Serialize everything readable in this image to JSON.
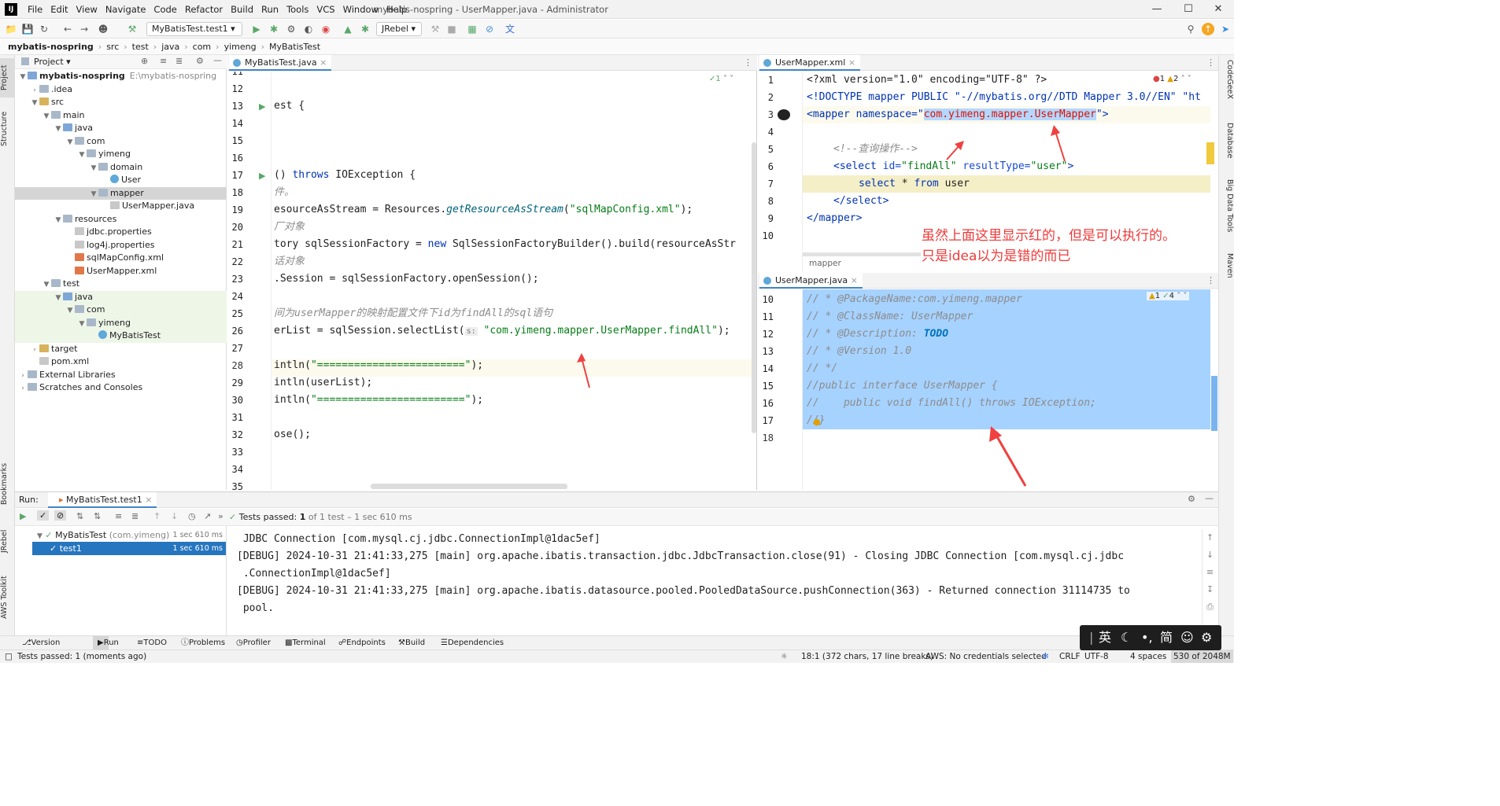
{
  "app": {
    "window_title": "mybatis-nospring - UserMapper.java - Administrator",
    "logo": "IJ",
    "menu": [
      "File",
      "Edit",
      "View",
      "Navigate",
      "Code",
      "Refactor",
      "Build",
      "Run",
      "Tools",
      "VCS",
      "Window",
      "Help"
    ]
  },
  "toolbar": {
    "run_config": "MyBatisTest.test1",
    "jrebel": "JRebel"
  },
  "breadcrumb": [
    "mybatis-nospring",
    "src",
    "test",
    "java",
    "com",
    "yimeng",
    "MyBatisTest"
  ],
  "left_stripe": {
    "project": "Project",
    "structure": "Structure",
    "bookmarks": "Bookmarks",
    "jrebel": "JRebel",
    "aws": "AWS Toolkit"
  },
  "right_stripe": {
    "codegeex": "CodeGeeX",
    "database": "Database",
    "bigdata": "Big Data Tools",
    "maven": "Maven"
  },
  "project": {
    "header": "Project",
    "root_path": "E:\\mybatis-nospring",
    "items": [
      {
        "label": "mybatis-nospring",
        "depth": 0
      },
      {
        "label": ".idea",
        "depth": 1
      },
      {
        "label": "src",
        "depth": 1
      },
      {
        "label": "main",
        "depth": 2
      },
      {
        "label": "java",
        "depth": 3
      },
      {
        "label": "com",
        "depth": 4
      },
      {
        "label": "yimeng",
        "depth": 5
      },
      {
        "label": "domain",
        "depth": 6
      },
      {
        "label": "User",
        "depth": 7
      },
      {
        "label": "mapper",
        "depth": 6
      },
      {
        "label": "UserMapper.java",
        "depth": 7
      },
      {
        "label": "resources",
        "depth": 3
      },
      {
        "label": "jdbc.properties",
        "depth": 4
      },
      {
        "label": "log4j.properties",
        "depth": 4
      },
      {
        "label": "sqlMapConfig.xml",
        "depth": 4
      },
      {
        "label": "UserMapper.xml",
        "depth": 4
      },
      {
        "label": "test",
        "depth": 2
      },
      {
        "label": "java",
        "depth": 3
      },
      {
        "label": "com",
        "depth": 4
      },
      {
        "label": "yimeng",
        "depth": 5
      },
      {
        "label": "MyBatisTest",
        "depth": 6
      },
      {
        "label": "target",
        "depth": 1
      },
      {
        "label": "pom.xml",
        "depth": 1
      },
      {
        "label": "External Libraries",
        "depth": 0
      },
      {
        "label": "Scratches and Consoles",
        "depth": 0
      }
    ]
  },
  "editor_left": {
    "tab": "MyBatisTest.java",
    "inspection": "1",
    "lines": [
      "11",
      "12",
      "13",
      "14",
      "15",
      "16",
      "17",
      "18",
      "19",
      "20",
      "21",
      "22",
      "23",
      "24",
      "25",
      "26",
      "27",
      "28",
      "29",
      "30",
      "31",
      "32",
      "33",
      "34",
      "35"
    ],
    "code": {
      "l13": "est {",
      "l17a": "() ",
      "l17b": "throws",
      "l17c": " IOException {",
      "l18": "件。",
      "l19a": "esourceAsStream = Resources.",
      "l19b": "getResourceAsStream",
      "l19c": "(",
      "l19d": "\"sqlMapConfig.xml\"",
      "l19e": ");",
      "l20": "厂对象",
      "l21a": "tory sqlSessionFactory = ",
      "l21b": "new",
      "l21c": " SqlSessionFactoryBuilder().build(resourceAsStr",
      "l22": "话对象",
      "l23": ".Session = sqlSessionFactory.openSession();",
      "l25": "间为userMapper的映射配置文件下id为findAll的sql语句",
      "l26a": "erList = sqlSession.selectList(",
      "l26hint": "s:",
      "l26b": "\"com.yimeng.mapper.UserMapper.findAll\"",
      "l26c": ");",
      "l28a": "intln(",
      "l28b": "\"========================\"",
      "l28c": ");",
      "l29": "intln(userList);",
      "l30a": "intln(",
      "l30b": "\"========================\"",
      "l30c": ");",
      "l32": "ose();"
    }
  },
  "editor_right_top": {
    "tab": "UserMapper.xml",
    "errors": "1",
    "warnings": "2",
    "lines": [
      "1",
      "2",
      "3",
      "4",
      "5",
      "6",
      "7",
      "8",
      "9",
      "10"
    ],
    "code": {
      "l1": "<?xml version=\"1.0\" encoding=\"UTF-8\" ?>",
      "l2": "<!DOCTYPE mapper PUBLIC \"-//mybatis.org//DTD Mapper 3.0//EN\" \"ht",
      "l3a": "<mapper namespace=\"",
      "l3b": "com.yimeng.mapper.UserMapper",
      "l3c": "\">",
      "l5": "<!--查询操作-->",
      "l6a": "<select ",
      "l6b": "id=",
      "l6c": "\"findAll\"",
      "l6d": " resultType=",
      "l6e": "\"user\"",
      "l6f": ">",
      "l7a": "select",
      "l7b": " * ",
      "l7c": "from",
      "l7d": " user",
      "l8": "</select>",
      "l9": "</mapper>"
    },
    "breadcrumb": "mapper",
    "annotation1": "虽然上面这里显示红的，但是可以执行的。",
    "annotation2": "只是idea以为是错的而已"
  },
  "editor_right_bottom": {
    "tab": "UserMapper.java",
    "warnings": "1",
    "checks": "4",
    "lines": [
      "10",
      "11",
      "12",
      "13",
      "14",
      "15",
      "16",
      "17",
      "18"
    ],
    "code": {
      "l10": "// * @PackageName:com.yimeng.mapper",
      "l11": "// * @ClassName: UserMapper",
      "l12a": "// * @Description: ",
      "l12b": "TODO",
      "l13": "// * @Version 1.0",
      "l14": "// */",
      "l15": "//public interface UserMapper {",
      "l16": "//    public void findAll() throws IOException;",
      "l17": "//}"
    }
  },
  "run": {
    "label": "Run:",
    "tab": "MyBatisTest.test1",
    "status_prefix": "Tests passed: ",
    "status_count": "1",
    "status_suffix": " of 1 test – 1 sec 610 ms",
    "tree": [
      {
        "label": "MyBatisTest",
        "sub": "(com.yimeng)",
        "time": "1 sec 610 ms"
      },
      {
        "label": "test1",
        "time": "1 sec 610 ms"
      }
    ],
    "console": [
      " JDBC Connection [com.mysql.cj.jdbc.ConnectionImpl@1dac5ef]",
      "[DEBUG] 2024-10-31 21:41:33,275 [main] org.apache.ibatis.transaction.jdbc.JdbcTransaction.close(91) - Closing JDBC Connection [com.mysql.cj.jdbc",
      " .ConnectionImpl@1dac5ef]",
      "[DEBUG] 2024-10-31 21:41:33,275 [main] org.apache.ibatis.datasource.pooled.PooledDataSource.pushConnection(363) - Returned connection 31114735 to",
      " pool."
    ]
  },
  "bottom_tabs": [
    "Version Control",
    "Run",
    "TODO",
    "Problems",
    "Profiler",
    "Terminal",
    "Endpoints",
    "Build",
    "Dependencies"
  ],
  "statusbar": {
    "left": "Tests passed: 1 (moments ago)",
    "position": "18:1 (372 chars, 17 line breaks)",
    "aws": "AWS: No credentials selected",
    "eol": "CRLF",
    "encoding": "UTF-8",
    "indent": "4 spaces",
    "memory": "530 of 2048M"
  },
  "ime": {
    "lang": "英",
    "mode": "简"
  },
  "colors": {
    "accent": "#4083c9",
    "selection": "#a6d2ff",
    "error_arrow": "#f04040",
    "pass": "#59a869"
  }
}
